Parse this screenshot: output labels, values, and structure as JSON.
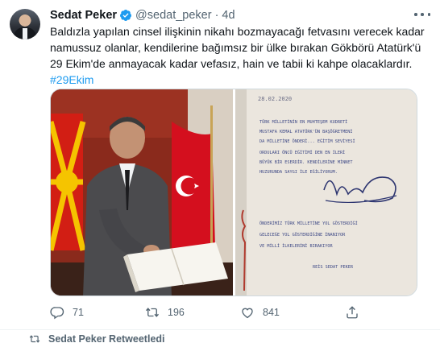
{
  "tweet": {
    "author": {
      "display_name": "Sedat Peker",
      "handle": "@sedat_peker",
      "separator": "·",
      "time": "4d",
      "verified": true
    },
    "text_lines": [
      "Baldızla yapılan cinsel ilişkinin nikahı bozmayacağı fetvasını verecek kadar",
      "namussuz olanlar, kendilerine bağımsız bir ülke bırakan Gökbörü Atatürk'ü",
      "29 Ekim'de anmayacak kadar vefasız, hain ve tabii ki kahpe olacaklardır."
    ],
    "hashtag": "#29Ekim",
    "media": {
      "left_photo": "man-signing-book",
      "right_photo": "handwritten-note"
    },
    "note": {
      "date": "28.02.2020",
      "lines": [
        "TÜRK MİLLETİNİN EN MUHTEŞEM KUDRETİ",
        "MUSTAFA KEMAL ATATÜRK'ÜN BAŞÖĞRETMENİ",
        "DA MİLLETİNE ÖNDERİ... EĞİTİM SEVİYESİ",
        "ORDULARI ÖNCÜ EĞİTİMİ DEN EN İLERİ",
        "BÜYÜK BİR ESERDİR. KENDİLERİNE MİNNET",
        "HUZURUNDA SAYGI İLE EĞİLİYORUM."
      ],
      "lines2": [
        "ÖNDERİMİZ TÜRK MİLLETİNE YOL GÖSTERDİĞİ",
        "GELECEĞE YOL GÖSTERDİĞİNE İNANIYOR",
        "VE MİLLİ İLKELERİNİ BIRAKIYOR"
      ],
      "signature_name": "REİS SEDAT PEKER"
    },
    "actions": {
      "reply_count": "71",
      "retweet_count": "196",
      "like_count": "841"
    },
    "colors": {
      "accent": "#1d9bf0",
      "secondary_text": "#536471",
      "border": "#cfd9de"
    }
  },
  "next_tweet": {
    "retweeted_by": "Sedat Peker Retweetledi"
  }
}
